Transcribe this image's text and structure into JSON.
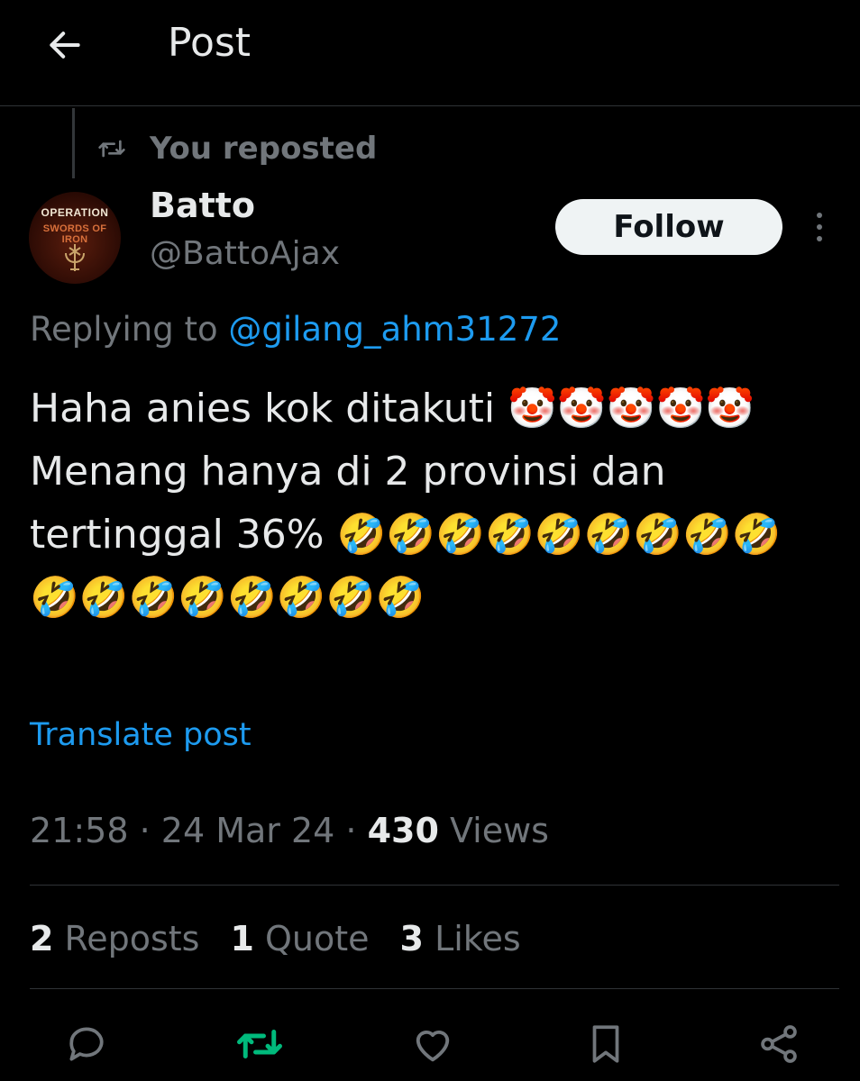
{
  "header": {
    "title": "Post"
  },
  "repost": {
    "label": "You reposted"
  },
  "author": {
    "name": "Batto",
    "handle": "@BattoAjax",
    "avatar_text_1": "OPERATION",
    "avatar_text_2": "SWORDS OF IRON",
    "follow_label": "Follow"
  },
  "reply": {
    "prefix": "Replying to ",
    "mention": "@gilang_ahm31272"
  },
  "post": {
    "text": "Haha anies kok ditakuti 🤡🤡🤡🤡🤡\nMenang hanya di 2 provinsi dan tertinggal 36% 🤣🤣🤣🤣🤣🤣🤣🤣🤣🤣🤣🤣🤣🤣🤣🤣🤣",
    "translate_label": "Translate post"
  },
  "meta": {
    "time": "21:58",
    "sep1": " · ",
    "date": "24 Mar 24",
    "sep2": " · ",
    "views_count": "430",
    "views_label": " Views"
  },
  "stats": {
    "reposts_count": "2",
    "reposts_label": " Reposts",
    "quotes_count": "1",
    "quotes_label": " Quote",
    "likes_count": "3",
    "likes_label": " Likes"
  },
  "colors": {
    "accent": "#1d9bf0",
    "repost_active": "#00ba7c",
    "muted": "#71767b",
    "text": "#e7e9ea"
  },
  "icons": [
    "back-arrow-icon",
    "repost-icon",
    "more-icon",
    "reply-icon",
    "retweet-icon",
    "like-icon",
    "bookmark-icon",
    "share-icon"
  ]
}
